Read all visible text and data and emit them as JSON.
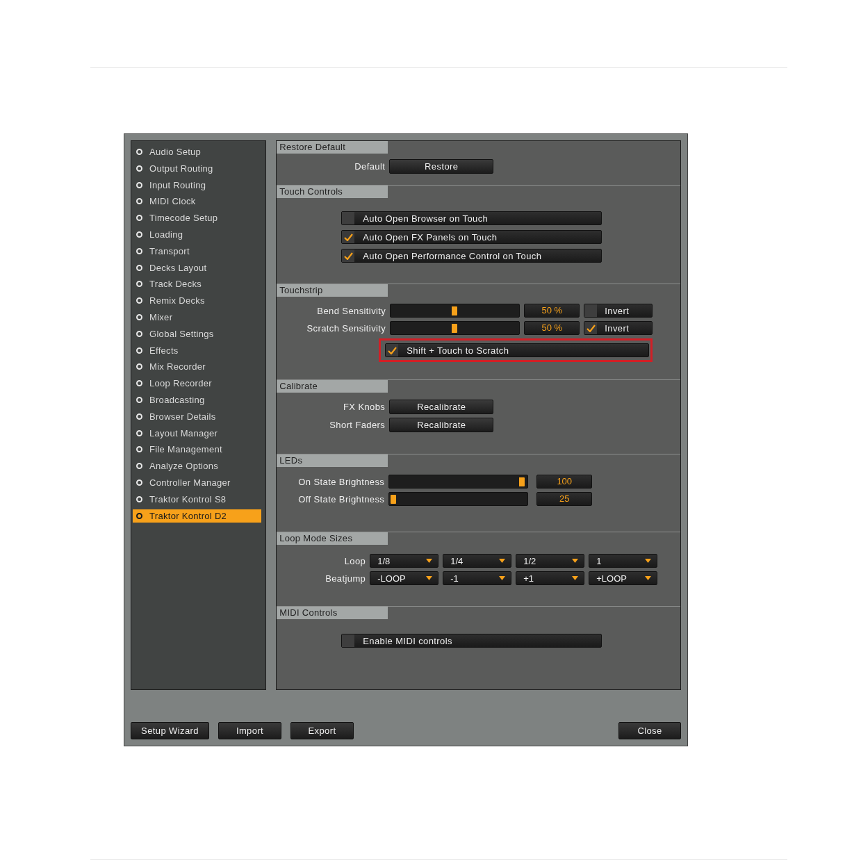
{
  "sidebar": {
    "items": [
      {
        "label": "Audio Setup",
        "selected": false
      },
      {
        "label": "Output Routing",
        "selected": false
      },
      {
        "label": "Input Routing",
        "selected": false
      },
      {
        "label": "MIDI Clock",
        "selected": false
      },
      {
        "label": "Timecode Setup",
        "selected": false
      },
      {
        "label": "Loading",
        "selected": false
      },
      {
        "label": "Transport",
        "selected": false
      },
      {
        "label": "Decks Layout",
        "selected": false
      },
      {
        "label": "Track Decks",
        "selected": false
      },
      {
        "label": "Remix Decks",
        "selected": false
      },
      {
        "label": "Mixer",
        "selected": false
      },
      {
        "label": "Global Settings",
        "selected": false
      },
      {
        "label": "Effects",
        "selected": false
      },
      {
        "label": "Mix Recorder",
        "selected": false
      },
      {
        "label": "Loop Recorder",
        "selected": false
      },
      {
        "label": "Broadcasting",
        "selected": false
      },
      {
        "label": "Browser Details",
        "selected": false
      },
      {
        "label": "Layout Manager",
        "selected": false
      },
      {
        "label": "File Management",
        "selected": false
      },
      {
        "label": "Analyze Options",
        "selected": false
      },
      {
        "label": "Controller Manager",
        "selected": false
      },
      {
        "label": "Traktor Kontrol S8",
        "selected": false
      },
      {
        "label": "Traktor Kontrol D2",
        "selected": true
      }
    ]
  },
  "sections": [
    {
      "title": "Restore Default",
      "rows": [
        {
          "kind": "button",
          "label": "Default",
          "button": "Restore"
        }
      ]
    },
    {
      "title": "Touch Controls",
      "rows": [
        {
          "kind": "checkbox",
          "label": "Auto Open Browser on Touch",
          "checked": false
        },
        {
          "kind": "checkbox",
          "label": "Auto Open FX Panels on Touch",
          "checked": true
        },
        {
          "kind": "checkbox",
          "label": "Auto Open Performance Control on Touch",
          "checked": true
        }
      ]
    },
    {
      "title": "Touchstrip",
      "rows": [
        {
          "kind": "slider",
          "label": "Bend Sensitivity",
          "level": 0.5,
          "value": "50 %",
          "invert": {
            "label": "Invert",
            "checked": false
          }
        },
        {
          "kind": "slider",
          "label": "Scratch Sensitivity",
          "level": 0.5,
          "value": "50 %",
          "invert": {
            "label": "Invert",
            "checked": true
          }
        },
        {
          "kind": "checkbox",
          "label": "Shift + Touch to Scratch",
          "checked": true,
          "highlighted": true
        }
      ]
    },
    {
      "title": "Calibrate",
      "rows": [
        {
          "kind": "button",
          "label": "FX Knobs",
          "button": "Recalibrate"
        },
        {
          "kind": "button",
          "label": "Short Faders",
          "button": "Recalibrate"
        }
      ]
    },
    {
      "title": "LEDs",
      "rows": [
        {
          "kind": "slider",
          "label": "On State Brightness",
          "level": 1,
          "value": "100"
        },
        {
          "kind": "slider",
          "label": "Off State Brightness",
          "level": 0,
          "value": "25"
        }
      ]
    },
    {
      "title": "Loop Mode Sizes",
      "rows": [
        {
          "kind": "dropdowns",
          "label": "Loop",
          "values": [
            "1/8",
            "1/4",
            "1/2",
            "1"
          ]
        },
        {
          "kind": "dropdowns",
          "label": "Beatjump",
          "values": [
            "-LOOP",
            "-1",
            "+1",
            "+LOOP"
          ]
        }
      ]
    },
    {
      "title": "MIDI Controls",
      "rows": [
        {
          "kind": "checkbox",
          "label": "Enable MIDI controls",
          "checked": false
        }
      ]
    }
  ],
  "footer": {
    "left_buttons": [
      "Setup Wizard",
      "Import",
      "Export"
    ],
    "close": "Close"
  }
}
